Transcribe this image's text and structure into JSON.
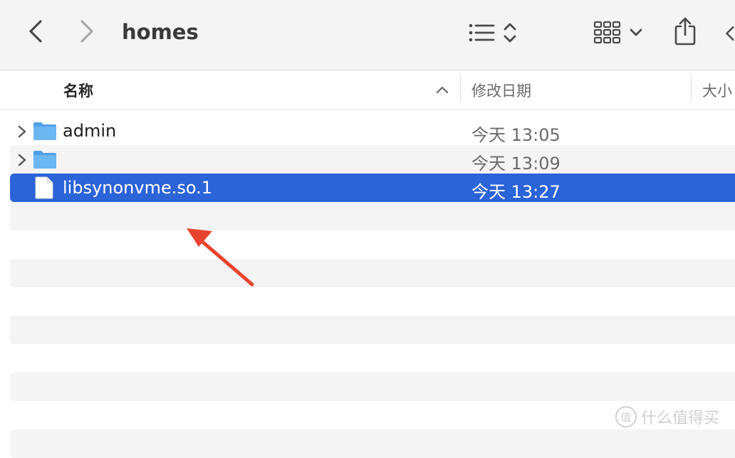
{
  "window": {
    "title": "homes"
  },
  "toolbar": {
    "back_icon": "chevron-left-icon",
    "forward_icon": "chevron-right-icon",
    "list_view_icon": "list-icon",
    "sort_icon": "updown-chevron-icon",
    "grid_view_icon": "grid-icon",
    "grid_dropdown_icon": "chevron-down-icon",
    "share_icon": "share-icon"
  },
  "columns": {
    "name": "名称",
    "modified": "修改日期",
    "size": "大小"
  },
  "files": [
    {
      "name": "admin",
      "modified": "今天 13:05",
      "kind": "folder",
      "expandable": true,
      "selected": false
    },
    {
      "name": "",
      "modified": "今天 13:09",
      "kind": "folder",
      "expandable": true,
      "selected": false
    },
    {
      "name": "libsynonvme.so.1",
      "modified": "今天 13:27",
      "kind": "file",
      "expandable": false,
      "selected": true
    }
  ],
  "annotation": {
    "type": "arrow",
    "color": "#e8432e"
  },
  "watermark": {
    "text": "什么值得买",
    "logo": "值"
  },
  "colors": {
    "selection": "#2b63d8",
    "toolbar_bg": "#f5f4f4",
    "folder_blue": "#5eaef0"
  }
}
